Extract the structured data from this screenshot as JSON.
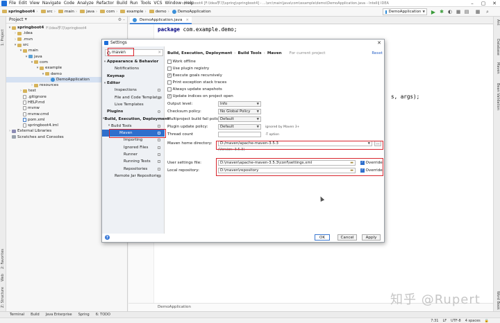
{
  "window": {
    "title": "springboot4 [F:\\Idea学习\\spring\\springboot4] - ...\\src\\main\\java\\com\\example\\demo\\DemoApplication.java - IntelliJ IDEA",
    "menu": [
      "File",
      "Edit",
      "View",
      "Navigate",
      "Code",
      "Analyze",
      "Refactor",
      "Build",
      "Run",
      "Tools",
      "VCS",
      "Window",
      "Help"
    ]
  },
  "navbar": {
    "breadcrumbs": [
      "springboot4",
      "src",
      "main",
      "java",
      "com",
      "example",
      "demo",
      "DemoApplication"
    ],
    "run_config": "DemoApplication"
  },
  "left_stripe": [
    "1: Project",
    "2: Favorites",
    "Web",
    "Z: Structure"
  ],
  "right_stripe": [
    "Ant",
    "Database",
    "Maven",
    "Bean Validation",
    "Word Book"
  ],
  "project_panel": {
    "title": "Project",
    "tree": [
      {
        "label": "springboot4",
        "path": "F:\\Idea学习\\springboot4",
        "bold": true
      },
      {
        "label": ".idea"
      },
      {
        "label": ".mvn"
      },
      {
        "label": "src"
      },
      {
        "label": "main"
      },
      {
        "label": "java"
      },
      {
        "label": "com"
      },
      {
        "label": "example"
      },
      {
        "label": "demo"
      },
      {
        "label": "DemoApplication"
      },
      {
        "label": "resources"
      },
      {
        "label": "test"
      },
      {
        "label": ".gitignore"
      },
      {
        "label": "HELP.md"
      },
      {
        "label": "mvnw"
      },
      {
        "label": "mvnw.cmd"
      },
      {
        "label": "pom.xml"
      },
      {
        "label": "springboot4.iml"
      },
      {
        "label": "External Libraries"
      },
      {
        "label": "Scratches and Consoles"
      }
    ]
  },
  "editor": {
    "tab": "DemoApplication.java",
    "code_keyword": "package",
    "code_rest": "com.example.demo;",
    "code_fragment": "s, args);",
    "bottom_label": "DemoApplication"
  },
  "settings_dialog": {
    "title": "Settings",
    "search_value": "maven",
    "nav": [
      {
        "label": "Appearance & Behavior",
        "bold": true
      },
      {
        "label": "Notifications"
      },
      {
        "label": "Keymap",
        "bold": true
      },
      {
        "label": "Editor",
        "bold": true
      },
      {
        "label": "Inspections"
      },
      {
        "label": "File and Code Templates"
      },
      {
        "label": "Live Templates"
      },
      {
        "label": "Plugins",
        "bold": true
      },
      {
        "label": "Build, Execution, Deployment",
        "bold": true
      },
      {
        "label": "Build Tools"
      },
      {
        "label": "Maven"
      },
      {
        "label": "Importing"
      },
      {
        "label": "Ignored Files"
      },
      {
        "label": "Runner"
      },
      {
        "label": "Running Tests"
      },
      {
        "label": "Repositories"
      },
      {
        "label": "Remote Jar Repositories"
      }
    ],
    "breadcrumb": [
      "Build, Execution, Deployment",
      "Build Tools",
      "Maven"
    ],
    "for_project": "For current project",
    "reset": "Reset",
    "checkboxes": [
      {
        "label": "Work offline",
        "checked": false
      },
      {
        "label": "Use plugin registry",
        "checked": false
      },
      {
        "label": "Execute goals recursively",
        "checked": true
      },
      {
        "label": "Print exception stack traces",
        "checked": false
      },
      {
        "label": "Always update snapshots",
        "checked": false
      },
      {
        "label": "Update indices on project open",
        "checked": true
      }
    ],
    "output_level": {
      "label": "Output level:",
      "value": "Info"
    },
    "checksum_policy": {
      "label": "Checksum policy:",
      "value": "No Global Policy"
    },
    "multiproject": {
      "label": "Multiproject build fail policy:",
      "value": "Default"
    },
    "plugin_update": {
      "label": "Plugin update policy:",
      "value": "Default",
      "note": "ignored by Maven 3+"
    },
    "thread_count": {
      "label": "Thread count",
      "value": "",
      "note": "-T option"
    },
    "maven_home": {
      "label": "Maven home directory:",
      "value": "D:/maven/apache-maven-3.5.3",
      "version": "(Version: 3.5.3)"
    },
    "user_settings": {
      "label": "User settings file:",
      "value": "D:\\maven\\apache-maven-3.5.3\\conf\\settings.xml",
      "override": "Override"
    },
    "local_repo": {
      "label": "Local repository:",
      "value": "D:\\maven\\repository",
      "override": "Override"
    },
    "buttons": {
      "ok": "OK",
      "cancel": "Cancel",
      "apply": "Apply"
    }
  },
  "tool_windows": [
    "Terminal",
    "Build",
    "Java Enterprise",
    "Spring",
    "6: TODO"
  ],
  "status": {
    "position": "7:31",
    "line_sep": "LF",
    "encoding": "UTF-8",
    "indent": "4 spaces"
  },
  "watermark": "知乎 @Rupert"
}
